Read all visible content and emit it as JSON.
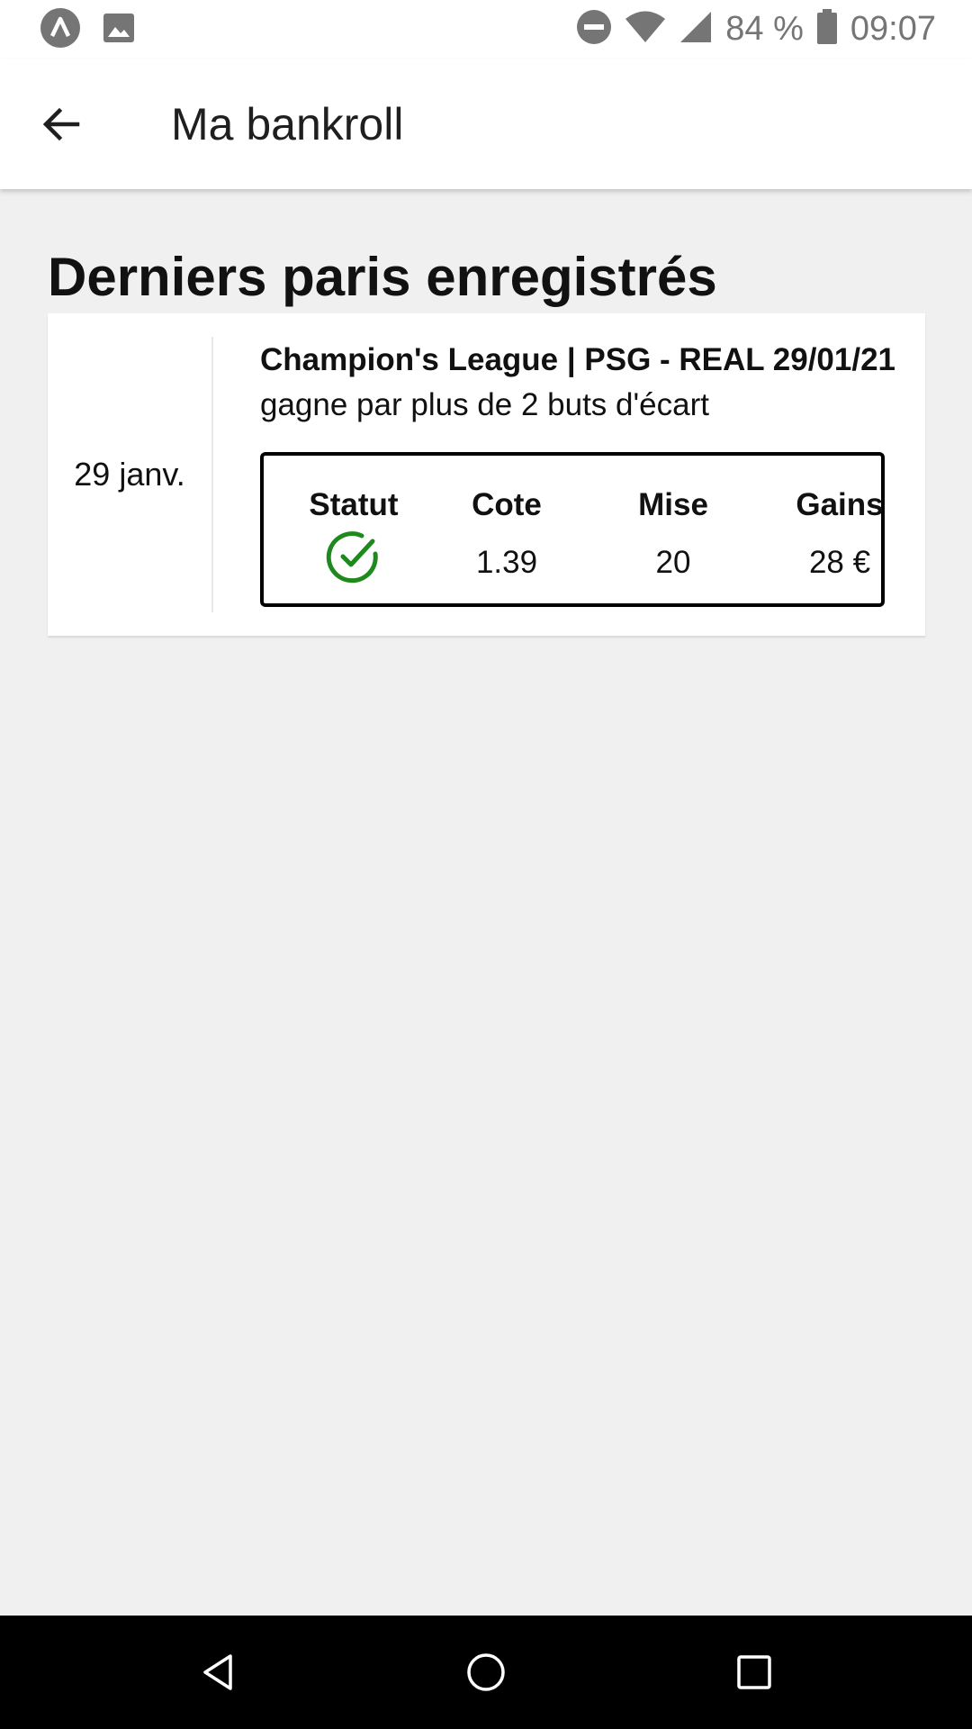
{
  "status_bar": {
    "battery_percent": "84 %",
    "time": "09:07",
    "left_icons": [
      "app-notification-icon",
      "image-icon"
    ],
    "right_icons": [
      "do-not-disturb-icon",
      "wifi-icon",
      "signal-icon",
      "battery-icon"
    ]
  },
  "app_bar": {
    "title": "Ma bankroll",
    "back_icon": "arrow-left-icon"
  },
  "section": {
    "title": "Derniers paris enregistrés"
  },
  "bets": [
    {
      "date": "29 janv.",
      "title": "Champion's League | PSG - REAL 29/01/21",
      "description": "gagne par plus de 2 buts d'écart",
      "stats": {
        "status_label": "Statut",
        "status_icon": "check-circle-icon",
        "odds_label": "Cote",
        "odds_value": "1.39",
        "stake_label": "Mise",
        "stake_value": "20",
        "winnings_label": "Gains",
        "winnings_value": "28 €"
      }
    }
  ],
  "nav_bar": {
    "buttons": [
      "back-triangle-icon",
      "home-circle-icon",
      "recents-square-icon"
    ]
  },
  "colors": {
    "background": "#f0f0f0",
    "card": "#ffffff",
    "success": "#1e8a1e",
    "nav_bar": "#000000"
  }
}
